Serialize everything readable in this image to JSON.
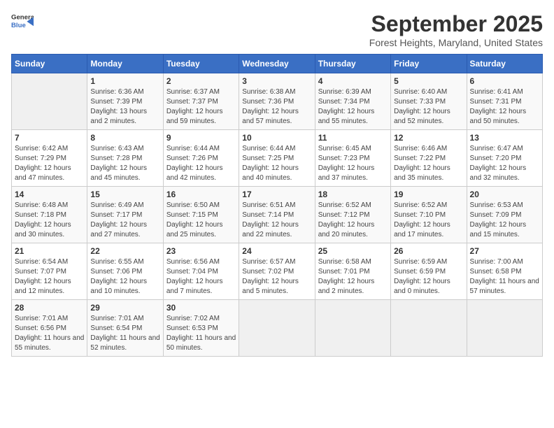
{
  "header": {
    "logo_general": "General",
    "logo_blue": "Blue",
    "month_title": "September 2025",
    "location": "Forest Heights, Maryland, United States"
  },
  "weekdays": [
    "Sunday",
    "Monday",
    "Tuesday",
    "Wednesday",
    "Thursday",
    "Friday",
    "Saturday"
  ],
  "weeks": [
    [
      {
        "day": "",
        "sunrise": "",
        "sunset": "",
        "daylight": ""
      },
      {
        "day": "1",
        "sunrise": "Sunrise: 6:36 AM",
        "sunset": "Sunset: 7:39 PM",
        "daylight": "Daylight: 13 hours and 2 minutes."
      },
      {
        "day": "2",
        "sunrise": "Sunrise: 6:37 AM",
        "sunset": "Sunset: 7:37 PM",
        "daylight": "Daylight: 12 hours and 59 minutes."
      },
      {
        "day": "3",
        "sunrise": "Sunrise: 6:38 AM",
        "sunset": "Sunset: 7:36 PM",
        "daylight": "Daylight: 12 hours and 57 minutes."
      },
      {
        "day": "4",
        "sunrise": "Sunrise: 6:39 AM",
        "sunset": "Sunset: 7:34 PM",
        "daylight": "Daylight: 12 hours and 55 minutes."
      },
      {
        "day": "5",
        "sunrise": "Sunrise: 6:40 AM",
        "sunset": "Sunset: 7:33 PM",
        "daylight": "Daylight: 12 hours and 52 minutes."
      },
      {
        "day": "6",
        "sunrise": "Sunrise: 6:41 AM",
        "sunset": "Sunset: 7:31 PM",
        "daylight": "Daylight: 12 hours and 50 minutes."
      }
    ],
    [
      {
        "day": "7",
        "sunrise": "Sunrise: 6:42 AM",
        "sunset": "Sunset: 7:29 PM",
        "daylight": "Daylight: 12 hours and 47 minutes."
      },
      {
        "day": "8",
        "sunrise": "Sunrise: 6:43 AM",
        "sunset": "Sunset: 7:28 PM",
        "daylight": "Daylight: 12 hours and 45 minutes."
      },
      {
        "day": "9",
        "sunrise": "Sunrise: 6:44 AM",
        "sunset": "Sunset: 7:26 PM",
        "daylight": "Daylight: 12 hours and 42 minutes."
      },
      {
        "day": "10",
        "sunrise": "Sunrise: 6:44 AM",
        "sunset": "Sunset: 7:25 PM",
        "daylight": "Daylight: 12 hours and 40 minutes."
      },
      {
        "day": "11",
        "sunrise": "Sunrise: 6:45 AM",
        "sunset": "Sunset: 7:23 PM",
        "daylight": "Daylight: 12 hours and 37 minutes."
      },
      {
        "day": "12",
        "sunrise": "Sunrise: 6:46 AM",
        "sunset": "Sunset: 7:22 PM",
        "daylight": "Daylight: 12 hours and 35 minutes."
      },
      {
        "day": "13",
        "sunrise": "Sunrise: 6:47 AM",
        "sunset": "Sunset: 7:20 PM",
        "daylight": "Daylight: 12 hours and 32 minutes."
      }
    ],
    [
      {
        "day": "14",
        "sunrise": "Sunrise: 6:48 AM",
        "sunset": "Sunset: 7:18 PM",
        "daylight": "Daylight: 12 hours and 30 minutes."
      },
      {
        "day": "15",
        "sunrise": "Sunrise: 6:49 AM",
        "sunset": "Sunset: 7:17 PM",
        "daylight": "Daylight: 12 hours and 27 minutes."
      },
      {
        "day": "16",
        "sunrise": "Sunrise: 6:50 AM",
        "sunset": "Sunset: 7:15 PM",
        "daylight": "Daylight: 12 hours and 25 minutes."
      },
      {
        "day": "17",
        "sunrise": "Sunrise: 6:51 AM",
        "sunset": "Sunset: 7:14 PM",
        "daylight": "Daylight: 12 hours and 22 minutes."
      },
      {
        "day": "18",
        "sunrise": "Sunrise: 6:52 AM",
        "sunset": "Sunset: 7:12 PM",
        "daylight": "Daylight: 12 hours and 20 minutes."
      },
      {
        "day": "19",
        "sunrise": "Sunrise: 6:52 AM",
        "sunset": "Sunset: 7:10 PM",
        "daylight": "Daylight: 12 hours and 17 minutes."
      },
      {
        "day": "20",
        "sunrise": "Sunrise: 6:53 AM",
        "sunset": "Sunset: 7:09 PM",
        "daylight": "Daylight: 12 hours and 15 minutes."
      }
    ],
    [
      {
        "day": "21",
        "sunrise": "Sunrise: 6:54 AM",
        "sunset": "Sunset: 7:07 PM",
        "daylight": "Daylight: 12 hours and 12 minutes."
      },
      {
        "day": "22",
        "sunrise": "Sunrise: 6:55 AM",
        "sunset": "Sunset: 7:06 PM",
        "daylight": "Daylight: 12 hours and 10 minutes."
      },
      {
        "day": "23",
        "sunrise": "Sunrise: 6:56 AM",
        "sunset": "Sunset: 7:04 PM",
        "daylight": "Daylight: 12 hours and 7 minutes."
      },
      {
        "day": "24",
        "sunrise": "Sunrise: 6:57 AM",
        "sunset": "Sunset: 7:02 PM",
        "daylight": "Daylight: 12 hours and 5 minutes."
      },
      {
        "day": "25",
        "sunrise": "Sunrise: 6:58 AM",
        "sunset": "Sunset: 7:01 PM",
        "daylight": "Daylight: 12 hours and 2 minutes."
      },
      {
        "day": "26",
        "sunrise": "Sunrise: 6:59 AM",
        "sunset": "Sunset: 6:59 PM",
        "daylight": "Daylight: 12 hours and 0 minutes."
      },
      {
        "day": "27",
        "sunrise": "Sunrise: 7:00 AM",
        "sunset": "Sunset: 6:58 PM",
        "daylight": "Daylight: 11 hours and 57 minutes."
      }
    ],
    [
      {
        "day": "28",
        "sunrise": "Sunrise: 7:01 AM",
        "sunset": "Sunset: 6:56 PM",
        "daylight": "Daylight: 11 hours and 55 minutes."
      },
      {
        "day": "29",
        "sunrise": "Sunrise: 7:01 AM",
        "sunset": "Sunset: 6:54 PM",
        "daylight": "Daylight: 11 hours and 52 minutes."
      },
      {
        "day": "30",
        "sunrise": "Sunrise: 7:02 AM",
        "sunset": "Sunset: 6:53 PM",
        "daylight": "Daylight: 11 hours and 50 minutes."
      },
      {
        "day": "",
        "sunrise": "",
        "sunset": "",
        "daylight": ""
      },
      {
        "day": "",
        "sunrise": "",
        "sunset": "",
        "daylight": ""
      },
      {
        "day": "",
        "sunrise": "",
        "sunset": "",
        "daylight": ""
      },
      {
        "day": "",
        "sunrise": "",
        "sunset": "",
        "daylight": ""
      }
    ]
  ]
}
